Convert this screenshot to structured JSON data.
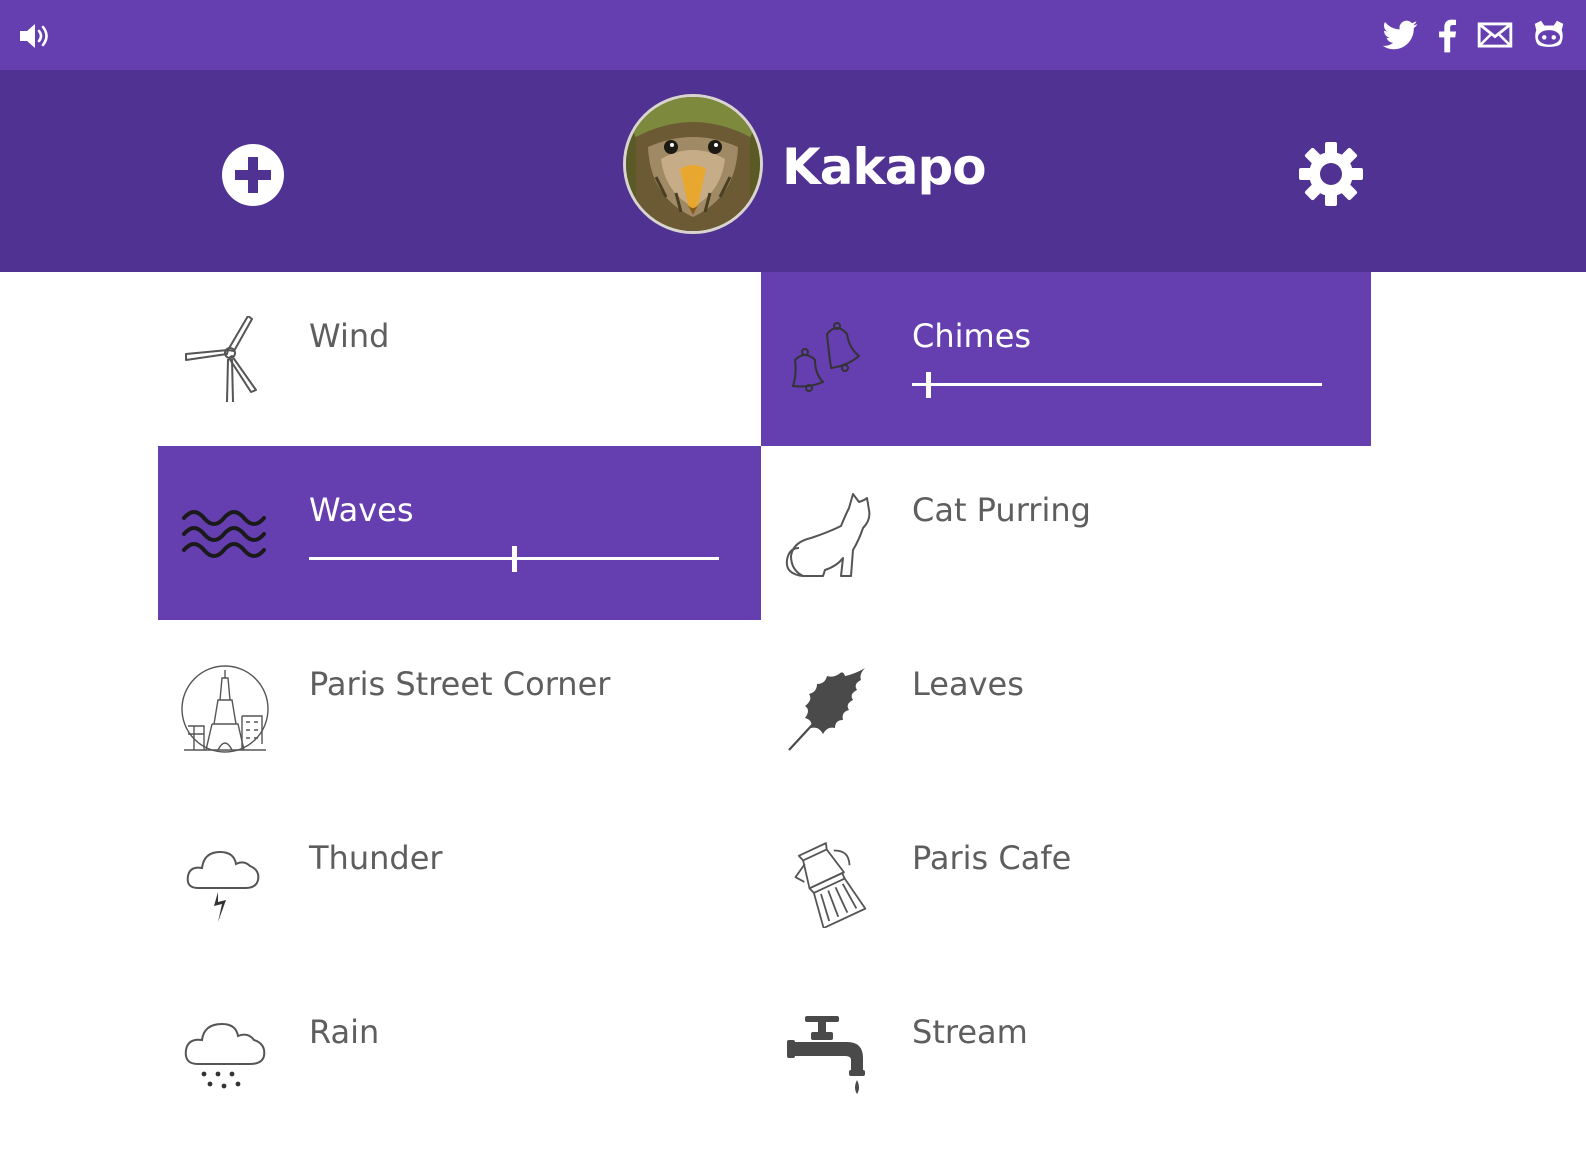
{
  "topbar": {
    "volume_icon": "speaker-volume-icon",
    "social": [
      "twitter-icon",
      "facebook-icon",
      "mail-icon",
      "github-icon"
    ]
  },
  "header": {
    "title": "Kakapo",
    "add_icon": "plus-circle-icon",
    "settings_icon": "gear-icon",
    "avatar": "kakapo-bird-avatar"
  },
  "colors": {
    "topbar": "#653eb0",
    "header": "#503292",
    "active_tile": "#653eb0",
    "label_text": "#5e5e5e"
  },
  "sounds": [
    {
      "label": "Wind",
      "icon": "wind-turbine-icon",
      "active": false
    },
    {
      "label": "Chimes",
      "icon": "bells-icon",
      "active": true,
      "volume": 0.04
    },
    {
      "label": "Waves",
      "icon": "waves-icon",
      "active": true,
      "volume": 0.5
    },
    {
      "label": "Cat Purring",
      "icon": "cat-icon",
      "active": false
    },
    {
      "label": "Paris Street Corner",
      "icon": "eiffel-tower-icon",
      "active": false
    },
    {
      "label": "Leaves",
      "icon": "leaf-icon",
      "active": false
    },
    {
      "label": "Thunder",
      "icon": "thunder-cloud-icon",
      "active": false
    },
    {
      "label": "Paris Cafe",
      "icon": "coffee-pot-icon",
      "active": false
    },
    {
      "label": "Rain",
      "icon": "rain-cloud-icon",
      "active": false
    },
    {
      "label": "Stream",
      "icon": "faucet-icon",
      "active": false
    }
  ]
}
